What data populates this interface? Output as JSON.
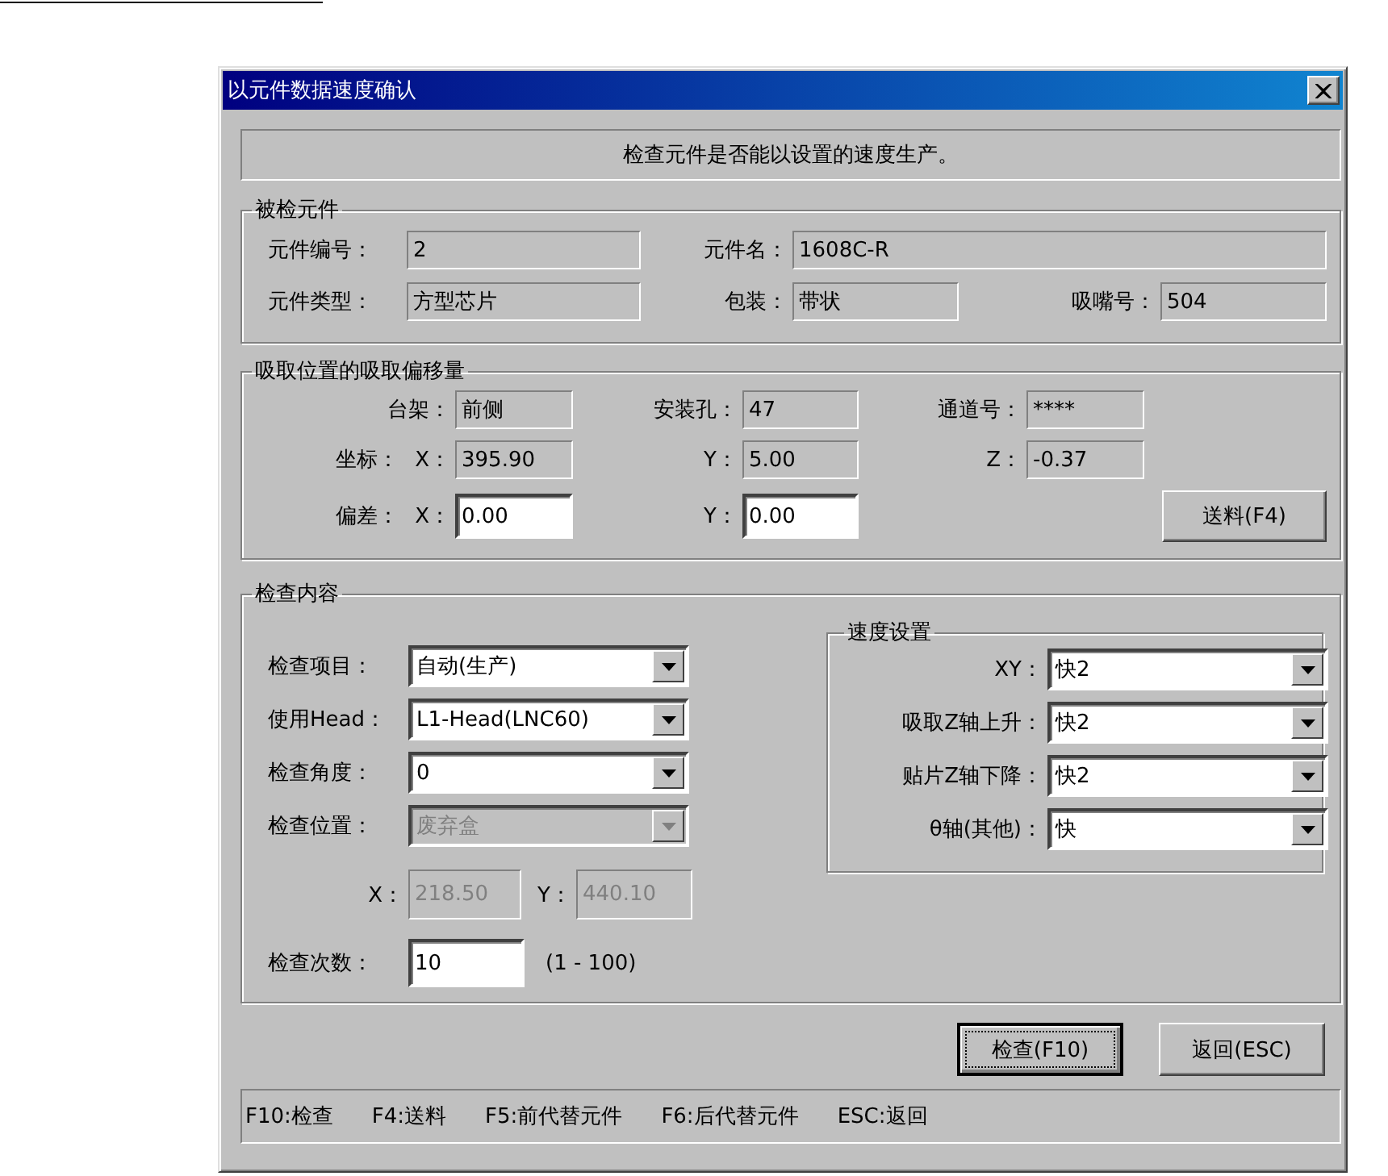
{
  "window": {
    "title": "以元件数据速度确认"
  },
  "message": "检查元件是否能以设置的速度生产。",
  "inspected_component": {
    "title": "被检元件",
    "fields": [
      {
        "label": "元件编号：",
        "value": "2"
      },
      {
        "label": "元件名：",
        "value": "1608C-R"
      },
      {
        "label": "元件类型：",
        "value": "方型芯片"
      },
      {
        "label": "包装：",
        "value": "带状"
      },
      {
        "label": "吸嘴号：",
        "value": "504"
      }
    ]
  },
  "pick_offset": {
    "title": "吸取位置的吸取偏移量",
    "rows": [
      {
        "items": [
          {
            "label": "台架：",
            "value": "前侧",
            "editable": false
          },
          {
            "label": "安装孔：",
            "value": "47",
            "editable": false
          },
          {
            "label": "通道号：",
            "value": "****",
            "editable": false
          }
        ]
      },
      {
        "label": "坐标：",
        "items": [
          {
            "label": "X：",
            "value": "395.90",
            "editable": false
          },
          {
            "label": "Y：",
            "value": "5.00",
            "editable": false
          },
          {
            "label": "Z：",
            "value": "-0.37",
            "editable": false
          }
        ]
      },
      {
        "label": "偏差：",
        "items": [
          {
            "label": "X：",
            "value": "0.00",
            "editable": true
          },
          {
            "label": "Y：",
            "value": "0.00",
            "editable": true
          }
        ],
        "button": "送料(F4)"
      }
    ]
  },
  "inspection": {
    "title": "检查内容",
    "dropdowns": [
      {
        "label": "检查项目：",
        "value": "自动(生产)",
        "disabled": false
      },
      {
        "label": "使用Head：",
        "value": "L1-Head(LNC60)",
        "disabled": false
      },
      {
        "label": "检查角度：",
        "value": "0",
        "disabled": false
      },
      {
        "label": "检查位置：",
        "value": "废弃盒",
        "disabled": true
      }
    ],
    "position": [
      {
        "label": "X：",
        "value": "218.50",
        "disabled": true
      },
      {
        "label": "Y：",
        "value": "440.10",
        "disabled": true
      }
    ],
    "count": {
      "label": "检查次数：",
      "value": "10",
      "range": "(1 - 100)"
    },
    "speed": {
      "title": "速度设置",
      "dropdowns": [
        {
          "label": "XY：",
          "value": "快2"
        },
        {
          "label": "吸取Z轴上升：",
          "value": "快2"
        },
        {
          "label": "贴片Z轴下降：",
          "value": "快2"
        },
        {
          "label": "θ轴(其他)：",
          "value": "快"
        }
      ]
    }
  },
  "buttons": [
    {
      "label": "检查(F10)",
      "focused": true
    },
    {
      "label": "返回(ESC)",
      "focused": false
    }
  ],
  "status_bar": [
    "F10:检查",
    "F4:送料",
    "F5:前代替元件",
    "F6:后代替元件",
    "ESC:返回"
  ]
}
